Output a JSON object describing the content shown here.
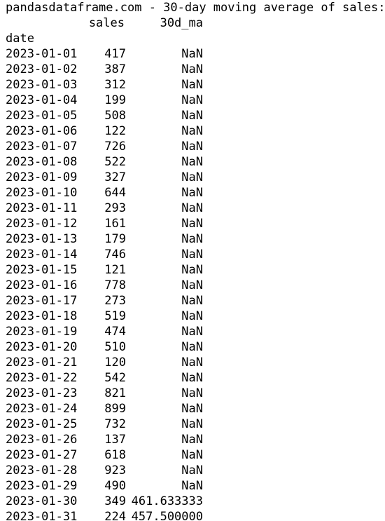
{
  "output": {
    "title": "pandasdataframe.com - 30-day moving average of sales:",
    "columns": [
      "sales",
      "30d_ma"
    ],
    "index_name": "date",
    "rows": [
      {
        "date": "2023-01-01",
        "sales": "417",
        "ma": "NaN"
      },
      {
        "date": "2023-01-02",
        "sales": "387",
        "ma": "NaN"
      },
      {
        "date": "2023-01-03",
        "sales": "312",
        "ma": "NaN"
      },
      {
        "date": "2023-01-04",
        "sales": "199",
        "ma": "NaN"
      },
      {
        "date": "2023-01-05",
        "sales": "508",
        "ma": "NaN"
      },
      {
        "date": "2023-01-06",
        "sales": "122",
        "ma": "NaN"
      },
      {
        "date": "2023-01-07",
        "sales": "726",
        "ma": "NaN"
      },
      {
        "date": "2023-01-08",
        "sales": "522",
        "ma": "NaN"
      },
      {
        "date": "2023-01-09",
        "sales": "327",
        "ma": "NaN"
      },
      {
        "date": "2023-01-10",
        "sales": "644",
        "ma": "NaN"
      },
      {
        "date": "2023-01-11",
        "sales": "293",
        "ma": "NaN"
      },
      {
        "date": "2023-01-12",
        "sales": "161",
        "ma": "NaN"
      },
      {
        "date": "2023-01-13",
        "sales": "179",
        "ma": "NaN"
      },
      {
        "date": "2023-01-14",
        "sales": "746",
        "ma": "NaN"
      },
      {
        "date": "2023-01-15",
        "sales": "121",
        "ma": "NaN"
      },
      {
        "date": "2023-01-16",
        "sales": "778",
        "ma": "NaN"
      },
      {
        "date": "2023-01-17",
        "sales": "273",
        "ma": "NaN"
      },
      {
        "date": "2023-01-18",
        "sales": "519",
        "ma": "NaN"
      },
      {
        "date": "2023-01-19",
        "sales": "474",
        "ma": "NaN"
      },
      {
        "date": "2023-01-20",
        "sales": "510",
        "ma": "NaN"
      },
      {
        "date": "2023-01-21",
        "sales": "120",
        "ma": "NaN"
      },
      {
        "date": "2023-01-22",
        "sales": "542",
        "ma": "NaN"
      },
      {
        "date": "2023-01-23",
        "sales": "821",
        "ma": "NaN"
      },
      {
        "date": "2023-01-24",
        "sales": "899",
        "ma": "NaN"
      },
      {
        "date": "2023-01-25",
        "sales": "732",
        "ma": "NaN"
      },
      {
        "date": "2023-01-26",
        "sales": "137",
        "ma": "NaN"
      },
      {
        "date": "2023-01-27",
        "sales": "618",
        "ma": "NaN"
      },
      {
        "date": "2023-01-28",
        "sales": "923",
        "ma": "NaN"
      },
      {
        "date": "2023-01-29",
        "sales": "490",
        "ma": "NaN"
      },
      {
        "date": "2023-01-30",
        "sales": "349",
        "ma": "461.633333"
      },
      {
        "date": "2023-01-31",
        "sales": "224",
        "ma": "457.500000"
      }
    ]
  },
  "style": {
    "text_color": "#000000",
    "background_color": "#ffffff"
  }
}
